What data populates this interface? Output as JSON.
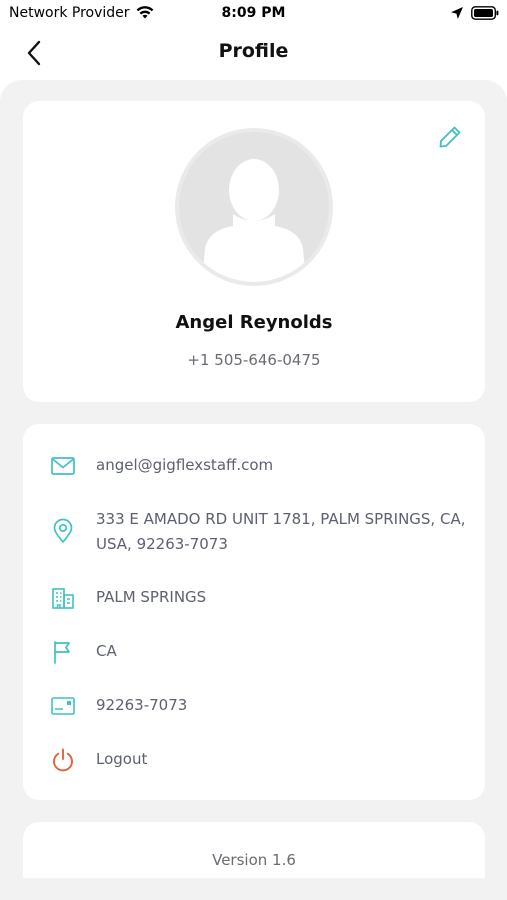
{
  "status_bar": {
    "carrier": "Network Provider",
    "time": "8:09 PM"
  },
  "nav": {
    "title": "Profile"
  },
  "profile": {
    "name": "Angel Reynolds",
    "phone": "+1 505-646-0475"
  },
  "details": {
    "email": "angel@gigflexstaff.com",
    "address": "333 E AMADO RD UNIT 1781, PALM SPRINGS, CA, USA, 92263-7073",
    "city": "PALM SPRINGS",
    "state": "CA",
    "zip": "92263-7073",
    "logout": "Logout"
  },
  "footer": {
    "version": "Version 1.6"
  },
  "colors": {
    "accent": "#3ec2c2",
    "logout": "#e4623a",
    "panel_bg": "#f2f2f2"
  }
}
